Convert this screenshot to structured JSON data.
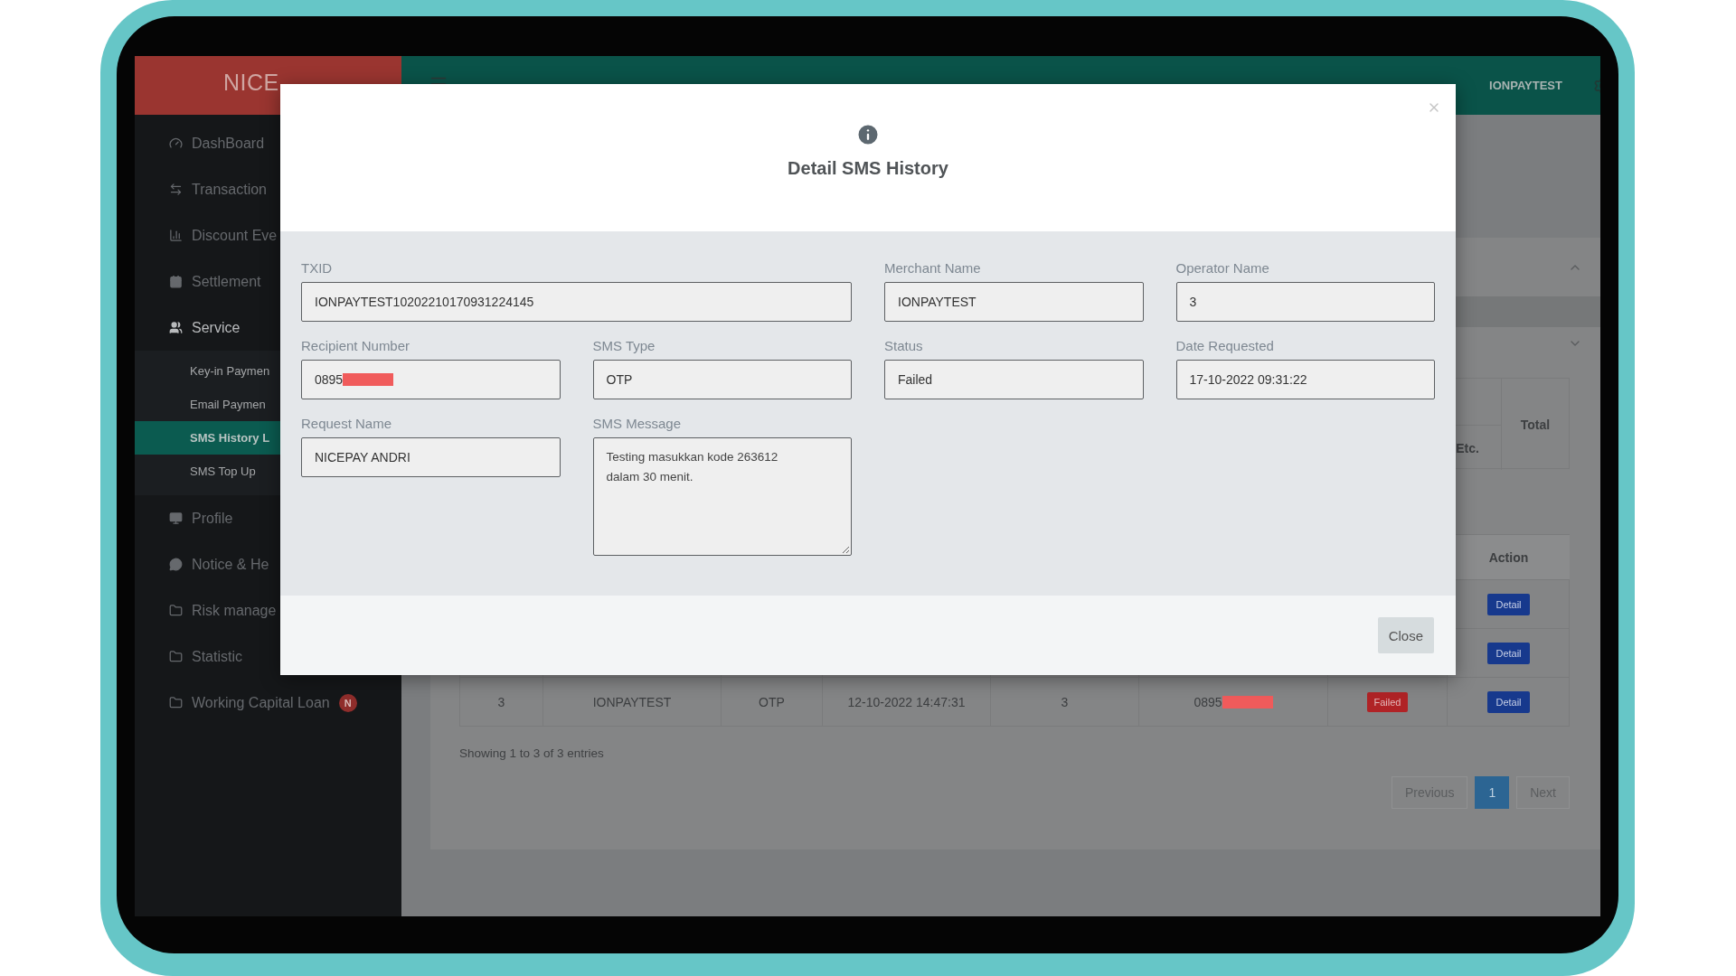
{
  "sidebar": {
    "logo": "NICE",
    "items": [
      {
        "label": "DashBoard",
        "expanded": false
      },
      {
        "label": "Transaction",
        "expanded": false
      },
      {
        "label": "Discount Eve",
        "expanded": false
      },
      {
        "label": "Settlement",
        "expanded": false
      },
      {
        "label": "Service",
        "expanded": true,
        "children": [
          {
            "label": "Key-in Paymen",
            "selected": false
          },
          {
            "label": "Email Paymen",
            "selected": false
          },
          {
            "label": "SMS History L",
            "selected": true
          },
          {
            "label": "SMS Top Up",
            "selected": false
          }
        ]
      },
      {
        "label": "Profile",
        "expanded": false
      },
      {
        "label": "Notice & He",
        "expanded": false
      },
      {
        "label": "Risk manage",
        "expanded": false
      },
      {
        "label": "Statistic",
        "expanded": false
      },
      {
        "label": "Working Capital Loan",
        "expanded": false,
        "badge": "N"
      }
    ]
  },
  "topbar": {
    "user": "IONPAYTEST"
  },
  "summary_table": {
    "columns": [
      "Etc.",
      "Total"
    ]
  },
  "table": {
    "columns": [
      "Action"
    ],
    "rows": [
      {
        "cells": [],
        "action": "Detail"
      },
      {
        "cells": [],
        "action": "Detail"
      },
      {
        "cells": [
          "3",
          "IONPAYTEST",
          "OTP",
          "12-10-2022 14:47:31",
          "3"
        ],
        "phone": "0895",
        "redacted": true,
        "status": "Failed",
        "action": "Detail"
      }
    ]
  },
  "table_info": "Showing 1 to 3 of 3 entries",
  "pagination": [
    {
      "label": "Previous",
      "selected": false
    },
    {
      "label": "1",
      "selected": true
    },
    {
      "label": "Next",
      "selected": false
    }
  ],
  "modal": {
    "title": "Detail SMS History",
    "close_label": "Close",
    "fields": [
      {
        "kind": "wide",
        "label": "TXID",
        "value": "IONPAYTEST10202210170931224145"
      },
      {
        "kind": "input",
        "label": "Merchant Name",
        "value": "IONPAYTEST"
      },
      {
        "kind": "input",
        "label": "Operator Name",
        "value": "3"
      },
      {
        "kind": "input",
        "label": "Recipient Number",
        "value": "0895",
        "redacted": true
      },
      {
        "kind": "input",
        "label": "SMS Type",
        "value": "OTP"
      },
      {
        "kind": "input",
        "label": "Status",
        "value": "Failed"
      },
      {
        "kind": "input",
        "label": "Date Requested",
        "value": "17-10-2022 09:31:22"
      },
      {
        "kind": "input",
        "label": "Request Name",
        "value": "NICEPAY ANDRI"
      },
      {
        "kind": "textarea",
        "label": "SMS Message",
        "value": "Testing masukkan kode 263612 dalam 30 menit."
      }
    ]
  }
}
